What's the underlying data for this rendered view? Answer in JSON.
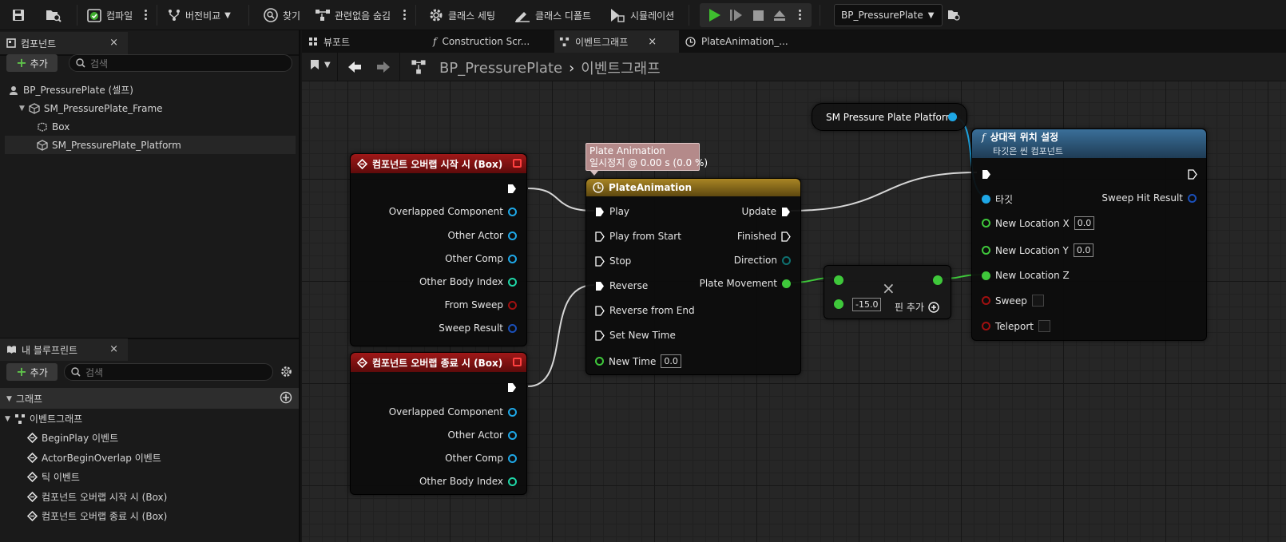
{
  "toolbar": {
    "compile": "컴파일",
    "diff": "버전비교",
    "find": "찾기",
    "hide_unrelated": "관련없음 숨김",
    "class_settings": "클래스 세팅",
    "class_defaults": "클래스 디폴트",
    "simulation": "시뮬레이션",
    "debug_object": "BP_PressurePlate"
  },
  "components_panel": {
    "tab_label": "컴포넌트",
    "add_label": "추가",
    "search_placeholder": "검색",
    "tree": [
      "BP_PressurePlate (셀프)",
      "SM_PressurePlate_Frame",
      "Box",
      "SM_PressurePlate_Platform"
    ]
  },
  "my_blueprint": {
    "tab_label": "내 블루프린트",
    "add_label": "추가",
    "search_placeholder": "검색",
    "section_graph": "그래프",
    "event_graph": "이벤트그래프",
    "events": [
      "BeginPlay 이벤트",
      "ActorBeginOverlap 이벤트",
      "틱 이벤트",
      "컴포넌트 오버랩 시작 시 (Box)",
      "컴포넌트 오버랩 종료 시 (Box)"
    ]
  },
  "doc_tabs": [
    "뷰포트",
    "Construction Scr...",
    "이벤트그래프",
    "PlateAnimation_..."
  ],
  "breadcrumb": {
    "blueprint": "BP_PressurePlate",
    "separator": "›",
    "graph": "이벤트그래프"
  },
  "graph": {
    "begin_overlap_node": {
      "title": "컴포넌트 오버랩 시작 시 (Box)",
      "pins": [
        "Overlapped Component",
        "Other Actor",
        "Other Comp",
        "Other Body Index",
        "From Sweep",
        "Sweep Result"
      ]
    },
    "end_overlap_node": {
      "title": "컴포넌트 오버랩 종료 시 (Box)",
      "pins": [
        "Overlapped Component",
        "Other Actor",
        "Other Comp",
        "Other Body Index"
      ]
    },
    "timeline_tooltip": {
      "line1": "Plate Animation",
      "line2": "일시정지 @ 0.00 s (0.0 %)"
    },
    "timeline_node": {
      "title": "PlateAnimation",
      "inputs": [
        "Play",
        "Play from Start",
        "Stop",
        "Reverse",
        "Reverse from End",
        "Set New Time",
        "New Time"
      ],
      "new_time_value": "0.0",
      "outputs": [
        "Update",
        "Finished",
        "Direction",
        "Plate Movement"
      ]
    },
    "multiply_node": {
      "symbol": "×",
      "value": "-15.0",
      "add_pin": "핀 추가"
    },
    "platform_var": "SM Pressure Plate Platform",
    "set_location_node": {
      "title": "상대적 위치 설정",
      "subtitle": "타깃은 씬 컴포넌트",
      "target": "타깃",
      "sweep_hit": "Sweep Hit Result",
      "loc_x": "New Location X",
      "loc_x_value": "0.0",
      "loc_y": "New Location Y",
      "loc_y_value": "0.0",
      "loc_z": "New Location Z",
      "sweep": "Sweep",
      "teleport": "Teleport"
    }
  },
  "colors": {
    "event_header": "#8f1010",
    "timeline_header": "#9a7b1c",
    "function_header": "#2f5f86",
    "exec": "#ffffff",
    "object_pin": "#1ea7e6",
    "float_pin": "#3fc83b",
    "bool_pin": "#a01010",
    "int_pin": "#1fd6a6",
    "struct_pin": "#1a4fb8"
  }
}
